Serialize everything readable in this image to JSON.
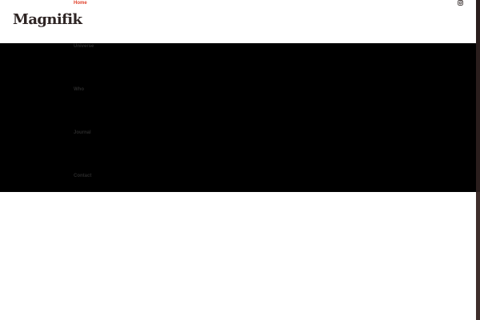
{
  "brand": {
    "logo_text": "Magnifik"
  },
  "nav": {
    "items": [
      {
        "label": "Home",
        "active": true
      },
      {
        "label": "Universe",
        "active": false
      },
      {
        "label": "Who",
        "active": false
      },
      {
        "label": "Journal",
        "active": false
      },
      {
        "label": "Contact",
        "active": false
      }
    ]
  },
  "social": {
    "icon": "instagram-icon"
  },
  "colors": {
    "accent": "#e0412b",
    "dark_band": "#000000",
    "logo": "#2e2524",
    "scrollbar": "#3e2e2c"
  }
}
